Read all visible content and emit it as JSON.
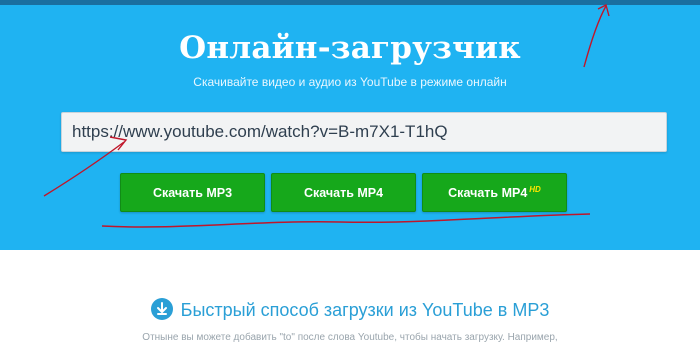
{
  "hero": {
    "title": "Онлайн-загрузчик",
    "subtitle": "Скачивайте видео и аудио из YouTube в режиме онлайн"
  },
  "url_input": {
    "value": "https://www.youtube.com/watch?v=B-m7X1-T1hQ"
  },
  "buttons": {
    "mp3": "Скачать MP3",
    "mp4": "Скачать MP4",
    "mp4hd": "Скачать MP4",
    "hd_badge": "HD"
  },
  "section": {
    "title": "Быстрый способ загрузки из YouTube в MP3",
    "description": "Отныне вы можете добавить \"to\" после слова Youtube, чтобы начать загрузку. Например,"
  },
  "colors": {
    "hero_bg": "#1fb3f2",
    "button_green": "#16a81b",
    "annotation_red": "#c0162a",
    "section_blue": "#2a9fd6"
  },
  "icons": {
    "section_icon": "download-icon"
  }
}
